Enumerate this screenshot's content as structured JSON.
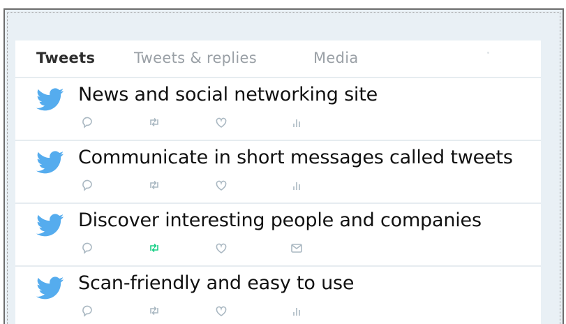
{
  "tabs": [
    {
      "label": "Tweets",
      "active": true
    },
    {
      "label": "Tweets & replies",
      "active": false
    },
    {
      "label": "Media",
      "active": false
    }
  ],
  "tweets": [
    {
      "text": "News and social networking site",
      "icons": [
        "reply-icon",
        "retweet-icon",
        "like-icon",
        "analytics-icon"
      ]
    },
    {
      "text": "Communicate in short messages called tweets",
      "icons": [
        "reply-icon",
        "retweet-icon",
        "like-icon",
        "analytics-icon"
      ]
    },
    {
      "text": "Discover interesting people and companies",
      "icons": [
        "reply-icon",
        "retweet-icon",
        "like-icon",
        "message-icon"
      ]
    },
    {
      "text": "Scan-friendly and easy to use",
      "icons": [
        "reply-icon",
        "retweet-icon",
        "like-icon",
        "analytics-icon"
      ]
    }
  ],
  "colors": {
    "bird": "#55acee",
    "icon": "#aab8c2",
    "retweet_active": "#19cf86",
    "background": "#e9f0f5"
  }
}
